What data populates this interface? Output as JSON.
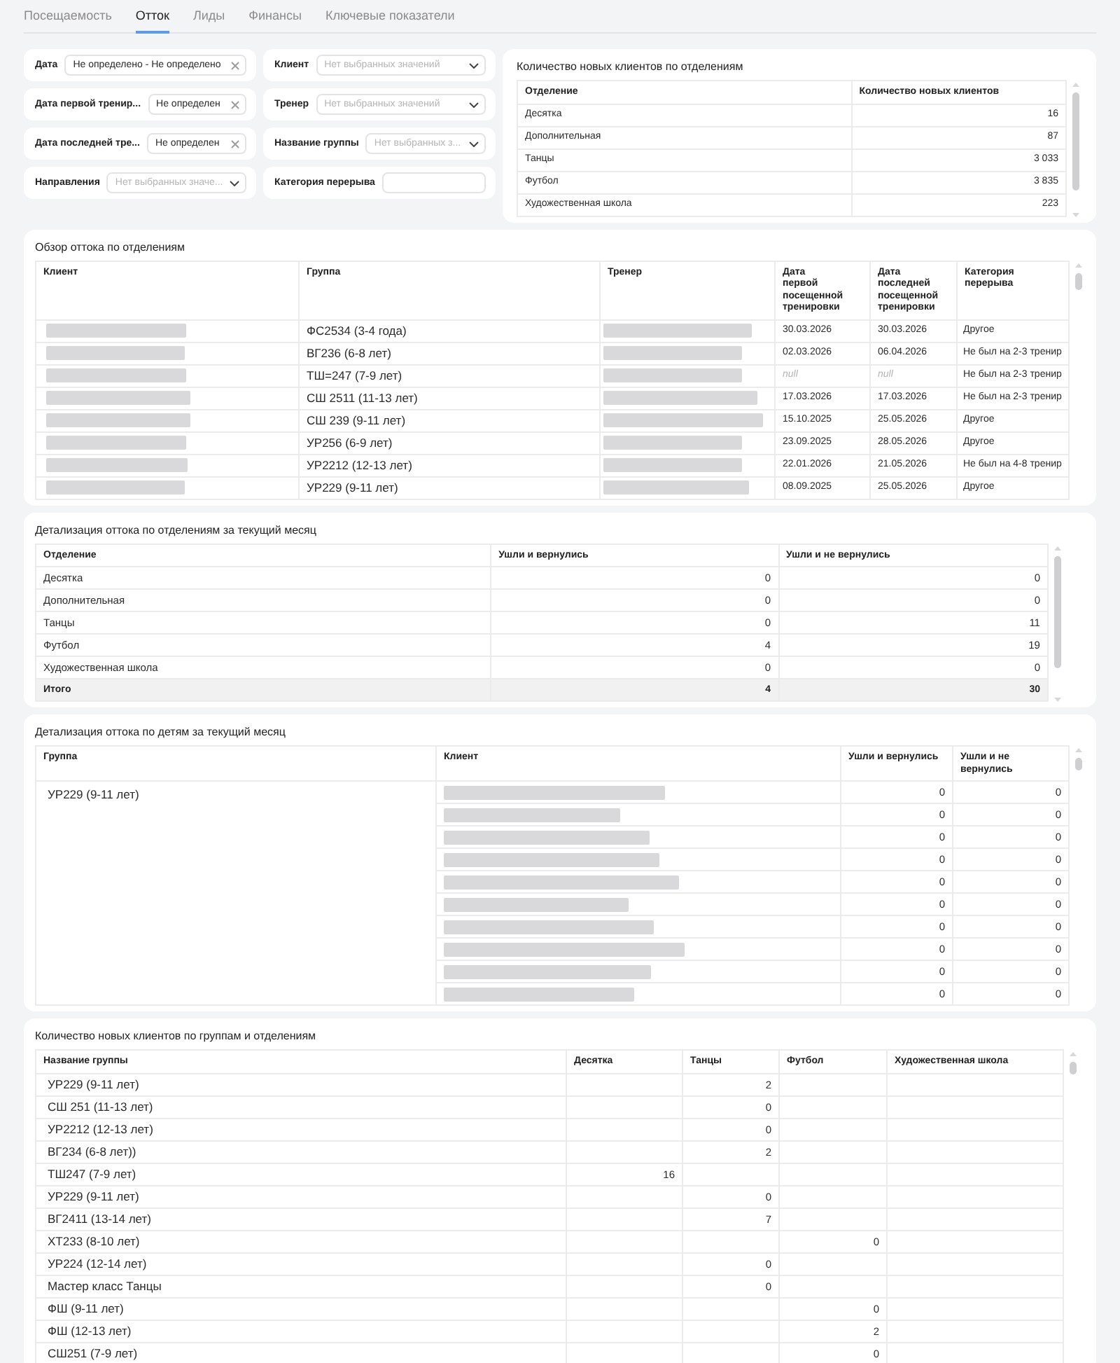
{
  "tabs": [
    {
      "label": "Посещаемость",
      "selected": false
    },
    {
      "label": "Отток",
      "selected": true
    },
    {
      "label": "Лиды",
      "selected": false
    },
    {
      "label": "Финансы",
      "selected": false
    },
    {
      "label": "Ключевые показатели",
      "selected": false
    }
  ],
  "filter_columns": [
    [
      {
        "label": "Дата",
        "kind": "date",
        "value": "Не определено - Не определено"
      },
      {
        "label": "Дата первой тренир...",
        "kind": "date",
        "value": "Не определен"
      },
      {
        "label": "Дата последней тре...",
        "kind": "date",
        "value": "Не определен"
      },
      {
        "label": "Направления",
        "kind": "select",
        "placeholder": "Нет выбранных значе..."
      }
    ],
    [
      {
        "label": "Клиент",
        "kind": "select",
        "placeholder": "Нет выбранных значений"
      },
      {
        "label": "Тренер",
        "kind": "select",
        "placeholder": "Нет выбранных значений"
      },
      {
        "label": "Название группы",
        "kind": "select",
        "placeholder": "Нет выбранных з..."
      },
      {
        "label": "Категория перерыва",
        "kind": "text"
      }
    ]
  ],
  "new_clients_by_department": {
    "title": "Количество новых клиентов по отделениям",
    "columns": [
      "Отделение",
      "Количество новых клиентов"
    ],
    "rows": [
      [
        "Десятка",
        "16"
      ],
      [
        "Дополнительная",
        "87"
      ],
      [
        "Танцы",
        "3 033"
      ],
      [
        "Футбол",
        "3 835"
      ],
      [
        "Художественная школа",
        "223"
      ]
    ]
  },
  "churn_overview": {
    "title": "Обзор оттока по отделениям",
    "columns": [
      "Клиент",
      "Группа",
      "Тренер",
      "Дата первой посещенной тренировки",
      "Дата последней посещенной тренировки",
      "Категория перерыва"
    ],
    "rows": [
      {
        "group": "ФС2534 (3-4 года)",
        "first_visit": "30.03.2026",
        "last_visit": "30.03.2026",
        "break_category": "Другое",
        "no_visit_dates": false
      },
      {
        "group": "ВГ236 (6-8 лет)",
        "first_visit": "02.03.2026",
        "last_visit": "06.04.2026",
        "break_category": "Не был на 2-3 тренир",
        "no_visit_dates": false
      },
      {
        "group": "ТШ=247 (7-9 лет)",
        "first_visit": "null",
        "last_visit": "null",
        "break_category": "Не был на 2-3 тренир",
        "no_visit_dates": true
      },
      {
        "group": "СШ 2511 (11-13 лет)",
        "first_visit": "17.03.2026",
        "last_visit": "17.03.2026",
        "break_category": "Не был на 2-3 тренир",
        "no_visit_dates": false
      },
      {
        "group": "СШ 239 (9-11 лет)",
        "first_visit": "15.10.2025",
        "last_visit": "25.05.2026",
        "break_category": "Другое",
        "no_visit_dates": false
      },
      {
        "group": "УР256 (6-9 лет)",
        "first_visit": "23.09.2025",
        "last_visit": "28.05.2026",
        "break_category": "Другое",
        "no_visit_dates": false
      },
      {
        "group": "УР2212 (12-13 лет)",
        "first_visit": "22.01.2026",
        "last_visit": "21.05.2026",
        "break_category": "Не был на 4-8 тренир",
        "no_visit_dates": false
      },
      {
        "group": "УР229 (9-11 лет)",
        "first_visit": "08.09.2025",
        "last_visit": "25.05.2026",
        "break_category": "Другое",
        "no_visit_dates": false
      }
    ]
  },
  "churn_by_department": {
    "title": "Детализация оттока по отделениям за текущий месяц",
    "columns": [
      "Отделение",
      "Ушли и вернулись",
      "Ушли и не вернулись"
    ],
    "rows": [
      [
        "Десятка",
        "0",
        "0"
      ],
      [
        "Дополнительная",
        "0",
        "0"
      ],
      [
        "Танцы",
        "0",
        "11"
      ],
      [
        "Футбол",
        "4",
        "19"
      ],
      [
        "Художественная школа",
        "0",
        "0"
      ]
    ],
    "total": [
      "Итого",
      "4",
      "30"
    ]
  },
  "churn_by_child": {
    "title": "Детализация оттока по детям за текущий месяц",
    "columns": [
      "Группа",
      "Клиент",
      "Ушли и вернулись",
      "Ушли и не вернулись"
    ],
    "groups": [
      {
        "group": "УР229 (9-11 лет)",
        "rows": [
          [
            "0",
            "0"
          ],
          [
            "0",
            "0"
          ],
          [
            "0",
            "0"
          ],
          [
            "0",
            "0"
          ],
          [
            "0",
            "0"
          ],
          [
            "0",
            "0"
          ],
          [
            "0",
            "0"
          ],
          [
            "0",
            "0"
          ],
          [
            "0",
            "0"
          ],
          [
            "0",
            "0"
          ]
        ]
      }
    ]
  },
  "new_clients_by_group": {
    "title": "Количество новых клиентов по группам и отделениям",
    "columns": [
      "Название группы",
      "Десятка",
      "Танцы",
      "Футбол",
      "Художественная школа"
    ],
    "rows": [
      {
        "group": "УР229 (9-11 лет)",
        "dance": "2"
      },
      {
        "group": "СШ 251 (11-13 лет)",
        "dance": "0"
      },
      {
        "group": "УР2212 (12-13 лет)",
        "dance": "0"
      },
      {
        "group": "ВГ234 (6-8 лет))",
        "dance": "2"
      },
      {
        "group": "ТШ247 (7-9 лет)",
        "ten": "16"
      },
      {
        "group": "УР229 (9-11 лет)",
        "dance": "0"
      },
      {
        "group": "ВГ2411 (13-14 лет)",
        "dance": "7"
      },
      {
        "group": "ХТ233 (8-10 лет)",
        "football": "0"
      },
      {
        "group": "УР224 (12-14 лет)",
        "dance": "0"
      },
      {
        "group": "Мастер класс Танцы",
        "dance": "0"
      },
      {
        "group": "ФШ (9-11 лет)",
        "football": "0"
      },
      {
        "group": "ФШ (12-13 лет)",
        "football": "2"
      },
      {
        "group": "СШ251 (7-9 лет)",
        "football": "0"
      }
    ]
  }
}
